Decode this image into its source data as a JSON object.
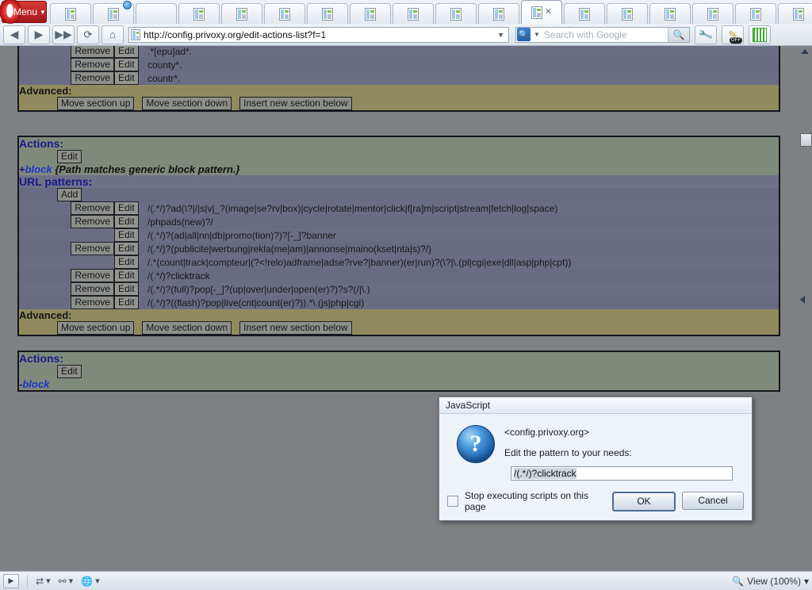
{
  "browser": {
    "menu_label": "Menu",
    "window_buttons": [
      "—",
      "❐",
      "✕"
    ],
    "nav": {
      "back": "back-arrow",
      "forward": "forward-arrow",
      "fastforward": "fast-forward-arrow",
      "reload": "reload-arrow",
      "home": "home-icon"
    },
    "url": "http://config.privoxy.org/edit-actions-list?f=1",
    "search_placeholder": "Search with Google",
    "tabs": [
      {
        "icon": "page-icon",
        "active": false
      },
      {
        "icon": "page-icon",
        "active": false,
        "badge": true
      },
      {
        "icon": "people-icon",
        "active": false
      },
      {
        "icon": "page-icon",
        "active": false
      },
      {
        "icon": "page-icon",
        "active": false
      },
      {
        "icon": "page-icon",
        "active": false
      },
      {
        "icon": "page-icon",
        "active": false
      },
      {
        "icon": "page-icon",
        "active": false
      },
      {
        "icon": "page-icon",
        "active": false
      },
      {
        "icon": "page-icon",
        "active": false
      },
      {
        "icon": "page-icon",
        "active": false
      },
      {
        "icon": "page-icon",
        "active": true,
        "close": "x"
      },
      {
        "icon": "page-icon",
        "active": false
      },
      {
        "icon": "page-icon",
        "active": false
      },
      {
        "icon": "page-icon",
        "active": false
      },
      {
        "icon": "page-icon",
        "active": false
      },
      {
        "icon": "page-icon",
        "active": false
      },
      {
        "icon": "page-icon",
        "active": false
      }
    ],
    "new_tab_label": "+",
    "trash_label": "trash-icon",
    "toolbuttons": [
      "wrench-icon",
      "pencil-off-icon",
      "qr-code-icon"
    ]
  },
  "statusbar": {
    "panel_toggle": "▶",
    "items": [
      "transfers-icon",
      "links-icon",
      "globe-icon"
    ],
    "zoom_label": "View (100%)",
    "zoom_icon": "magnifier-icon",
    "zoom_carat": "▾"
  },
  "page": {
    "section_top": {
      "url_rows": [
        {
          "remove": "Remove",
          "edit": "Edit",
          "pattern": ".*[epu]ad*."
        },
        {
          "remove": "Remove",
          "edit": "Edit",
          "pattern": "county*."
        },
        {
          "remove": "Remove",
          "edit": "Edit",
          "pattern": "countr*."
        }
      ],
      "advanced_label": "Advanced:",
      "advanced_buttons": [
        "Move section up",
        "Move section down",
        "Insert new section below"
      ]
    },
    "section_main": {
      "actions_label": "Actions:",
      "edit_label": "Edit",
      "action_sign": "+",
      "action_name": "block",
      "action_desc": "{Path matches generic block pattern.}",
      "url_patterns_label": "URL patterns:",
      "add_label": "Add",
      "url_rows": [
        {
          "remove": "Remove",
          "edit": "Edit",
          "pattern": "/(.*/)?ad(\\?|/|s|v|_?(image|se?rv|box)|cycle|rotate|mentor|click|f[ra]m|script|stream|fetch|log|space)"
        },
        {
          "remove": "Remove",
          "edit": "Edit",
          "pattern": "/phpads(new)?/"
        },
        {
          "remove": "",
          "edit": "Edit",
          "pattern": "/(.*/)?(ad|all|nn|db|promo(tion)?)?[-_]?banner"
        },
        {
          "remove": "Remove",
          "edit": "Edit",
          "pattern": "/(.*/)?(publicite|werbung|rekla(me|am)|annonse|maino(kset|nta|s)?/)"
        },
        {
          "remove": "",
          "edit": "Edit",
          "pattern": "/.*(count|track|compteur|(?<!relo)adframe|adse?rve?|banner)(er|run)?(\\?|\\.(pl|cgi|exe|dll|asp|php|cpt))"
        },
        {
          "remove": "Remove",
          "edit": "Edit",
          "pattern": "/(.*/)?clicktrack"
        },
        {
          "remove": "Remove",
          "edit": "Edit",
          "pattern": "/(.*/)?(full)?pop[-_]?(up|over|under|open(er)?)?s?(/|\\.)"
        },
        {
          "remove": "Remove",
          "edit": "Edit",
          "pattern": "/(.*/)?((flash)?pop|live(cnt|count(er)?)).*\\.(js|php|cgi)"
        }
      ],
      "advanced_label": "Advanced:",
      "advanced_buttons": [
        "Move section up",
        "Move section down",
        "Insert new section below"
      ]
    },
    "section_bottom": {
      "actions_label": "Actions:",
      "edit_label": "Edit",
      "action_sign": "-",
      "action_name": "block"
    }
  },
  "dialog": {
    "titlebar": "JavaScript",
    "icon": "question-icon",
    "host": "<config.privoxy.org>",
    "prompt": "Edit the pattern to your needs:",
    "input_value": "/(.*/)?clicktrack",
    "checkbox_label": "Stop executing scripts on this page",
    "checkbox_checked": false,
    "ok_label": "OK",
    "cancel_label": "Cancel"
  },
  "colors": {
    "accent": "#1a1a8c",
    "section_bg": "#808a7c",
    "row_bg": "#6b6d85",
    "advanced_bg": "#908b5e",
    "page_dim": "#7f8083"
  }
}
